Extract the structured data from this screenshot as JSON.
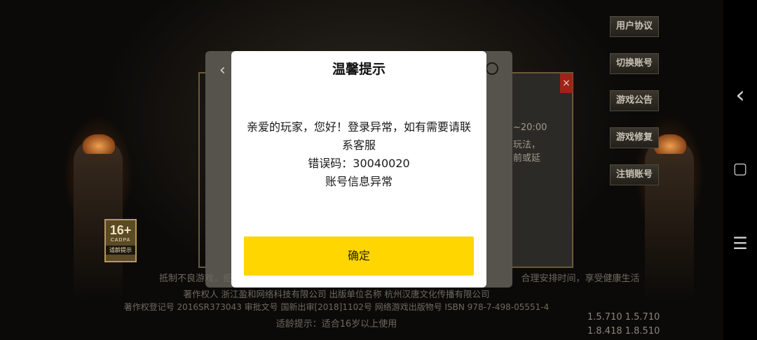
{
  "modal": {
    "title": "温馨提示",
    "message_line1": "亲爱的玩家，您好！登录异常，如有需要请联",
    "message_line2": "系客服",
    "error_code": "错误码：30040020",
    "error_detail": "账号信息异常",
    "confirm_label": "确定"
  },
  "side_menu": [
    "用户协议",
    "切换账号",
    "游戏公告",
    "游戏修复",
    "注销账号"
  ],
  "age_badge": {
    "number": "16+",
    "sub": "CADPA",
    "tip": "适龄提示"
  },
  "background_dialog": {
    "close_label": "×",
    "partial_lines": [
      "~20:00",
      "玩法，",
      "前或延"
    ]
  },
  "footer": {
    "line1_left": "抵制不良游戏，拒绝盗",
    "line1_right": "合理安排时间，享受健康生活",
    "line2": "著作权人 浙江盈和网络科技有限公司 出版单位名称 杭州汉唐文化传播有限公司",
    "line3": "著作权登记号 2016SR373043 审批文号 国新出审[2018]1102号 网络游戏出版物号 ISBN 978-7-498-05551-4",
    "line4": "适龄提示：适合16岁以上使用"
  },
  "versions": [
    "1.5.710  1.5.710",
    "1.8.418  1.8.510"
  ],
  "navbar": {
    "back": "‹",
    "home": "▢",
    "menu": "☰"
  }
}
